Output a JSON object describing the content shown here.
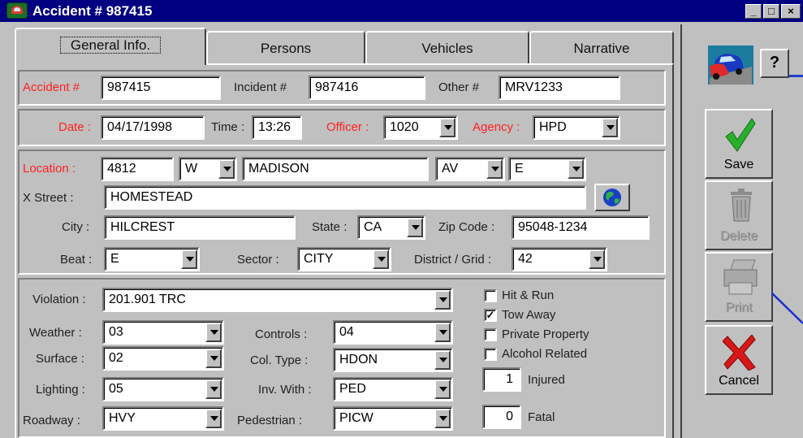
{
  "window": {
    "title": "Accident # 987415",
    "controls": {
      "minimize": "_",
      "maximize": "□",
      "close": "×"
    }
  },
  "tabs": [
    {
      "label": "General Info.",
      "active": true
    },
    {
      "label": "Persons",
      "active": false
    },
    {
      "label": "Vehicles",
      "active": false
    },
    {
      "label": "Narrative",
      "active": false
    }
  ],
  "ids": {
    "accident_label": "Accident #",
    "accident_value": "987415",
    "incident_label": "Incident #",
    "incident_value": "987416",
    "other_label": "Other #",
    "other_value": "MRV1233"
  },
  "datetime": {
    "date_label": "Date :",
    "date_value": "04/17/1998",
    "time_label": "Time :",
    "time_value": "13:26",
    "officer_label": "Officer :",
    "officer_value": "1020",
    "agency_label": "Agency :",
    "agency_value": "HPD"
  },
  "location": {
    "location_label": "Location :",
    "number": "4812",
    "direction": "W",
    "street": "MADISON",
    "type": "AV",
    "suffix": "E",
    "xstreet_label": "X Street :",
    "xstreet_value": "HOMESTEAD",
    "city_label": "City :",
    "city_value": "HILCREST",
    "state_label": "State :",
    "state_value": "CA",
    "zip_label": "Zip Code :",
    "zip_value": "95048-1234",
    "beat_label": "Beat :",
    "beat_value": "E",
    "sector_label": "Sector :",
    "sector_value": "CITY",
    "district_label": "District / Grid :",
    "district_value": "42"
  },
  "conditions": {
    "violation_label": "Violation :",
    "violation_value": "201.901 TRC",
    "weather_label": "Weather :",
    "weather_value": "03",
    "surface_label": "Surface :",
    "surface_value": "02",
    "lighting_label": "Lighting :",
    "lighting_value": "05",
    "roadway_label": "Roadway :",
    "roadway_value": "HVY",
    "controls_label": "Controls :",
    "controls_value": "04",
    "coltype_label": "Col. Type :",
    "coltype_value": "HDON",
    "invwith_label": "Inv. With :",
    "invwith_value": "PED",
    "pedestrian_label": "Pedestrian :",
    "pedestrian_value": "PICW"
  },
  "flags": [
    {
      "label": "Hit & Run",
      "checked": false,
      "mark": ""
    },
    {
      "label": "Tow Away",
      "checked": true,
      "mark": "✓"
    },
    {
      "label": "Private Property",
      "checked": false,
      "mark": ""
    },
    {
      "label": "Alcohol Related",
      "checked": false,
      "mark": ""
    }
  ],
  "counts": {
    "injured_value": "1",
    "injured_label": "Injured",
    "fatal_value": "0",
    "fatal_label": "Fatal"
  },
  "actions": {
    "help_label": "?",
    "save_label": "Save",
    "delete_label": "Delete",
    "print_label": "Print",
    "cancel_label": "Cancel"
  },
  "colors": {
    "titlebar": "#000080",
    "required_label": "#ff2020",
    "window_bg": "#c0c0c0"
  }
}
